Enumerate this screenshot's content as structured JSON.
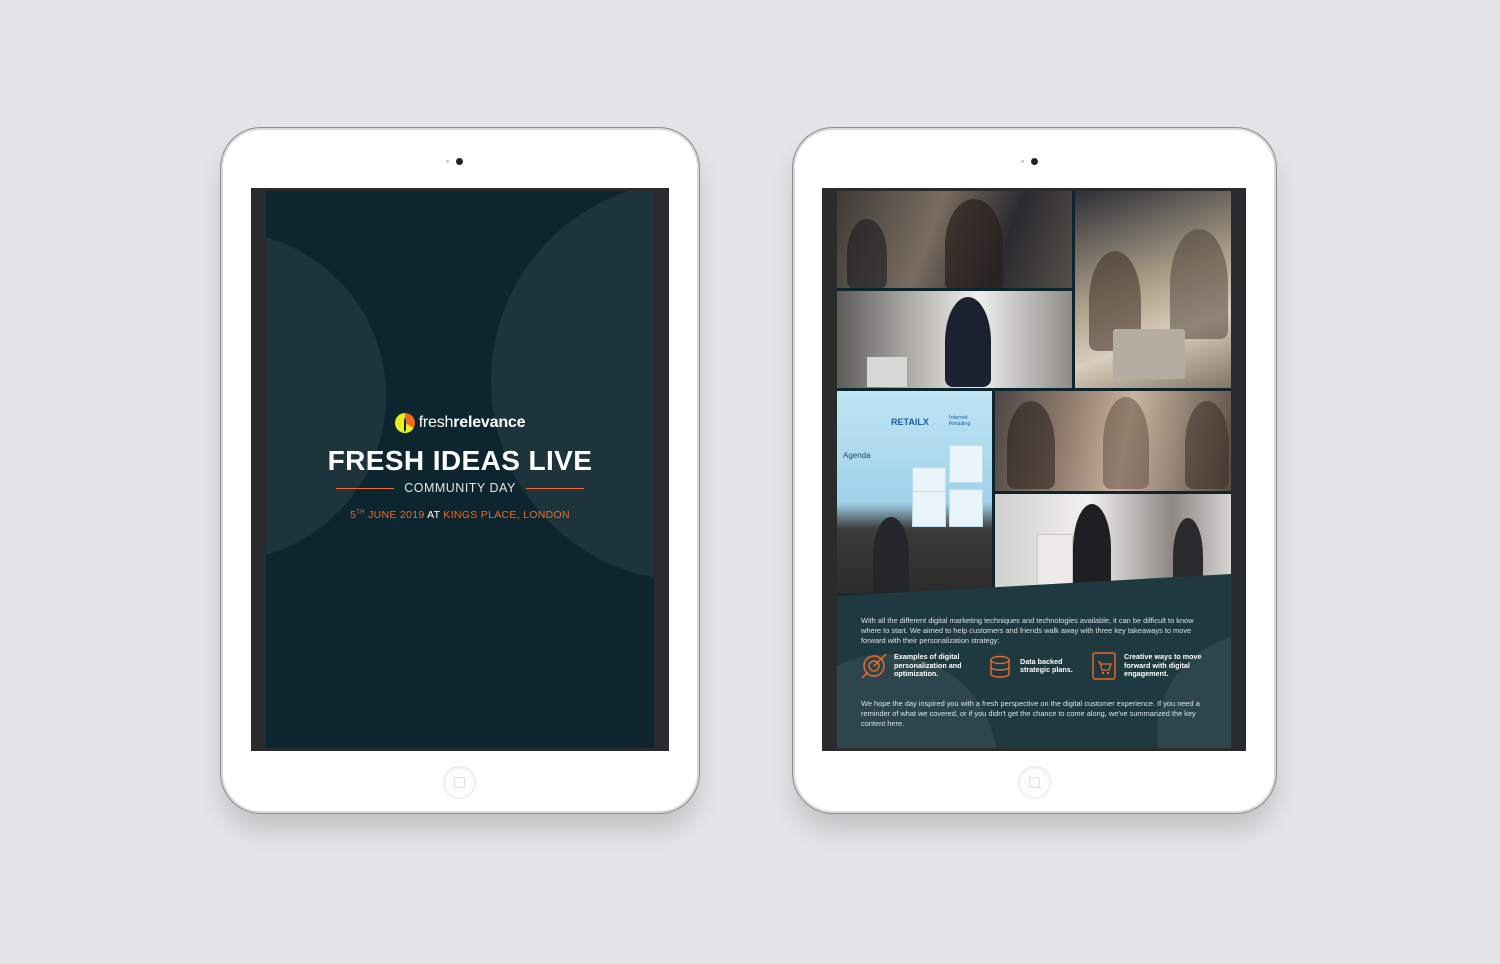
{
  "cover": {
    "logo": {
      "prefix": "fresh",
      "suffix": "relevance"
    },
    "title": "FRESH IDEAS LIVE",
    "subtitle": "COMMUNITY DAY",
    "date_day": "5",
    "date_sup": "TH",
    "date_rest": " JUNE 2019",
    "date_at": " AT ",
    "venue": "KINGS PLACE, LONDON"
  },
  "inside": {
    "slide": {
      "brand_a": "RETAILX",
      "brand_b": "Internet Retailing",
      "heading": "Agenda"
    },
    "intro": "With all the different digital marketing techniques and technologies available, it can be difficult to know where to start. We aimed to help customers and friends walk away with three key takeaways to move forward with their personalization strategy:",
    "takeaways": [
      {
        "icon": "target-icon",
        "label": "Examples of digital personalization and optimization."
      },
      {
        "icon": "database-icon",
        "label": "Data backed strategic plans."
      },
      {
        "icon": "tablet-cart-icon",
        "label": "Creative ways to move forward with digital engagement."
      }
    ],
    "outro": "We hope the day inspired you with a fresh perspective on the digital customer experience. If you need a reminder of what we covered, or if you didn't get the chance to come along, we've summarized the key content here."
  },
  "colors": {
    "background": "#e4e5e6",
    "page": "#0c252e",
    "accent": "#f06a26",
    "logo_yellow": "#e8ef1c"
  }
}
